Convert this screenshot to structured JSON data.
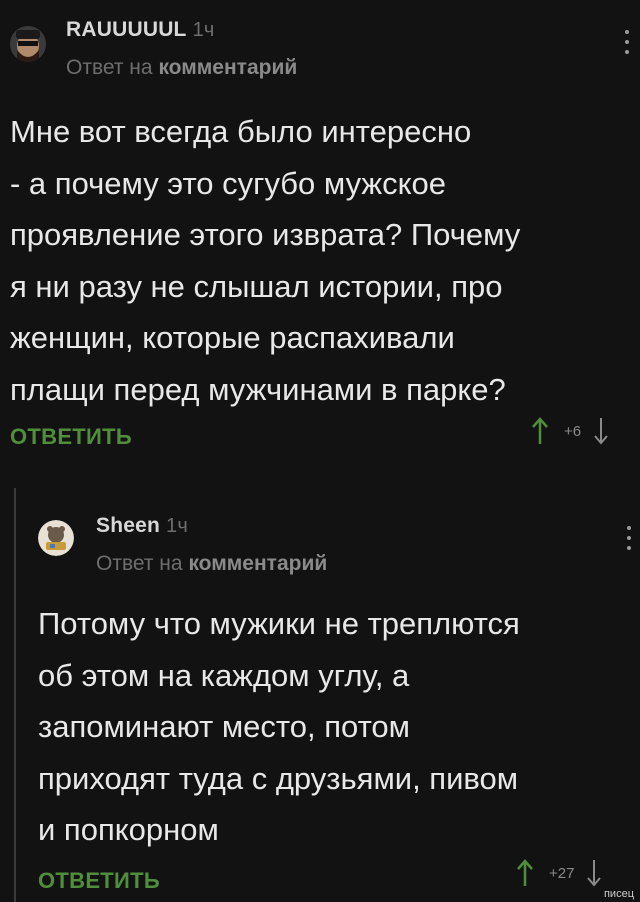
{
  "comments": [
    {
      "author": "RAUUUUUL",
      "time": "1ч",
      "reply_prefix": "Ответ на",
      "reply_target": "комментарий",
      "text": "Мне вот всегда было интересно\n- а почему это сугубо мужское\nпроявление этого изврата? Почему\nя ни разу не слышал истории, про\nженщин, которые распахивали\nплащи перед мужчинами в парке?",
      "reply_label": "ОТВЕТИТЬ",
      "rating": "+6"
    },
    {
      "author": "Sheen",
      "time": "1ч",
      "reply_prefix": "Ответ на",
      "reply_target": "комментарий",
      "text": "Потому что мужики не треплются\nоб этом на каждом углу, а\nзапоминают место, потом\nприходят туда с друзьями, пивом\nи попкорном",
      "reply_label": "ОТВЕТИТЬ",
      "rating": "+27"
    }
  ],
  "watermark": "писец",
  "colors": {
    "background": "#121212",
    "accent_green": "#4f8f3a",
    "muted": "#6e6e6e"
  },
  "icons": [
    "avatar-image",
    "menu-dots-icon",
    "upvote-arrow-icon",
    "downvote-arrow-icon"
  ]
}
